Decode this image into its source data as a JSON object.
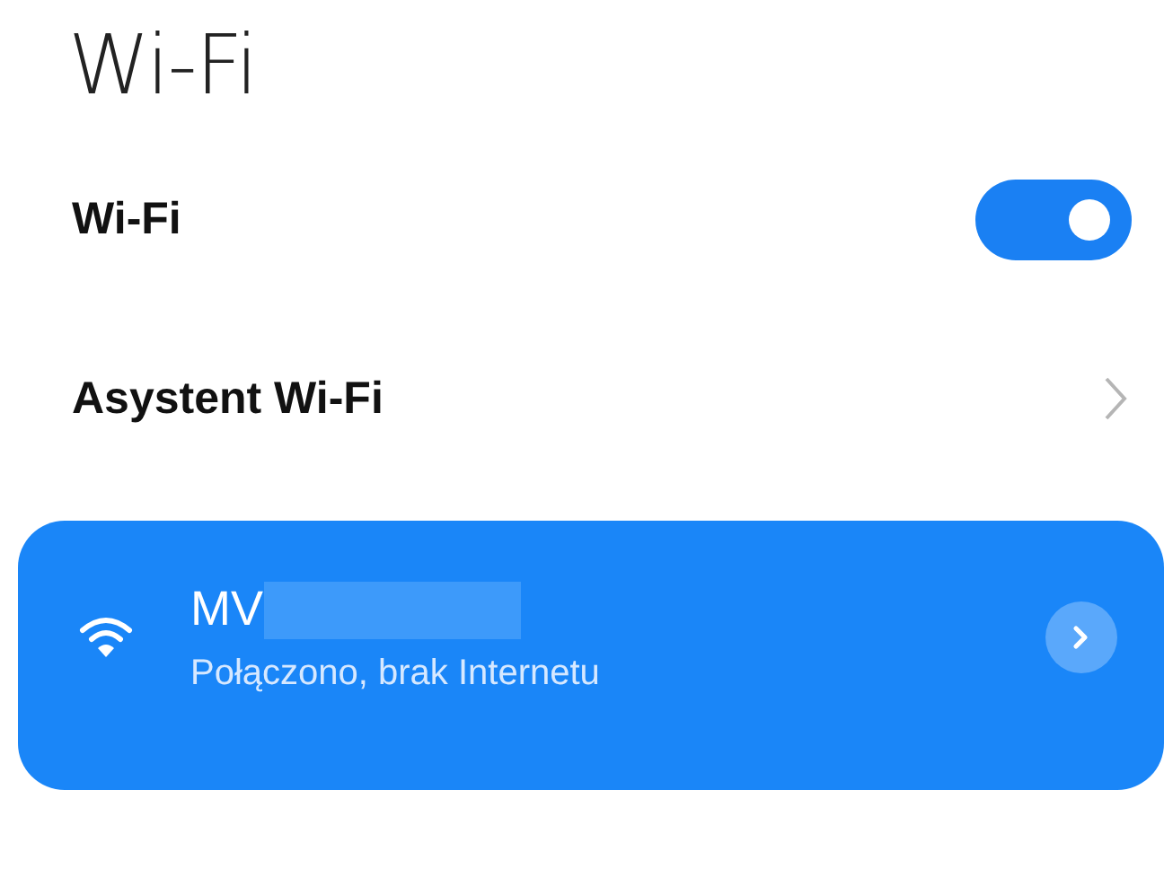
{
  "title": "Wi-Fi",
  "settings": [
    {
      "kind": "toggle",
      "label": "Wi-Fi",
      "on": true
    },
    {
      "kind": "link",
      "label": "Asystent Wi-Fi"
    }
  ],
  "network": {
    "name": "MV",
    "status": "Połączono, brak Internetu"
  }
}
